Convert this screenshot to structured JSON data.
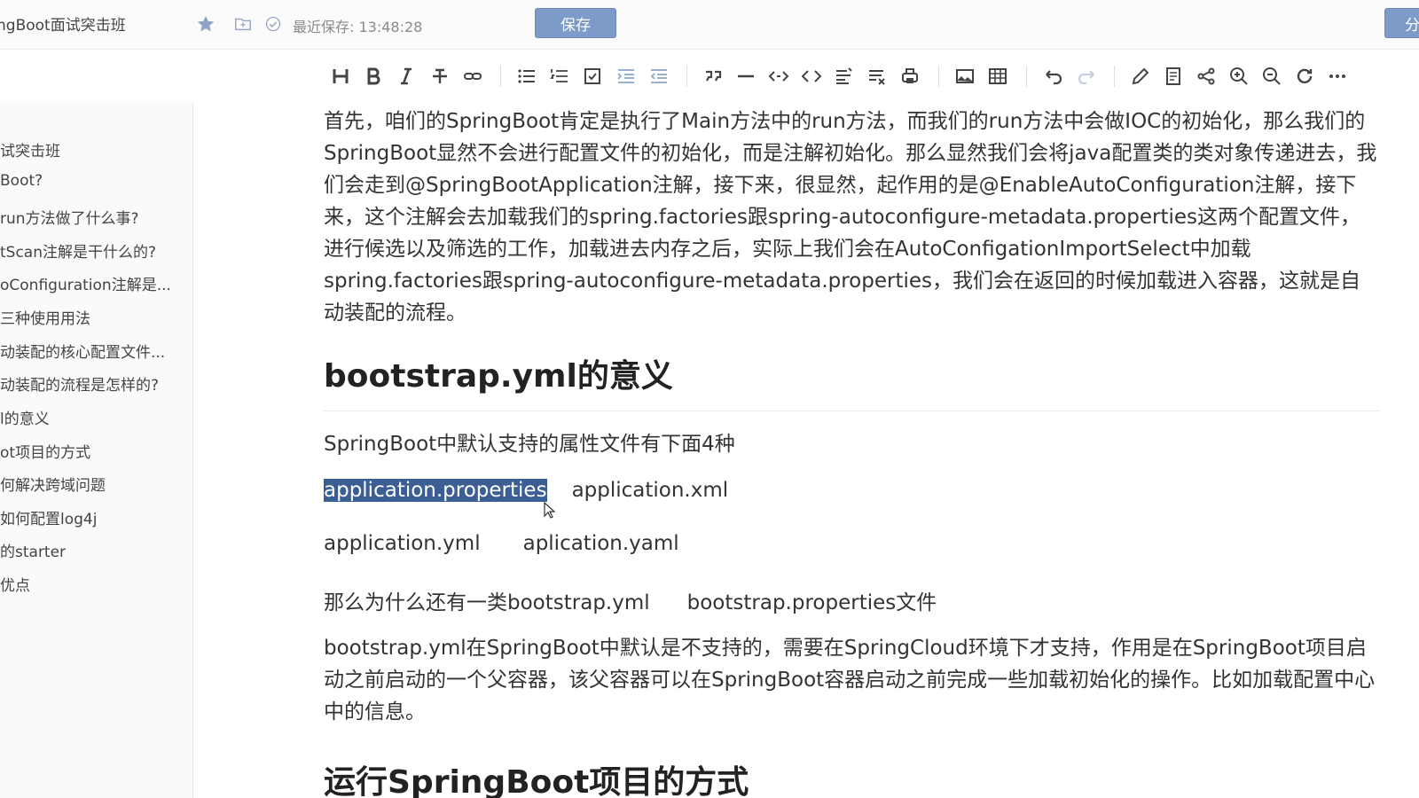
{
  "topbar": {
    "doc_title": "ngBoot面试突击班",
    "save_status": "最近保存: 13:48:28",
    "save_label": "保存",
    "share_label": "分"
  },
  "toolbar": {
    "icons": [
      "heading-icon",
      "bold-icon",
      "italic-icon",
      "strikethrough-icon",
      "link-icon",
      "unordered-list-icon",
      "ordered-list-icon",
      "task-list-icon",
      "indent-icon",
      "outdent-icon",
      "quote-icon",
      "horizontal-rule-icon",
      "inline-code-icon",
      "code-block-icon",
      "align-icon",
      "clear-format-icon",
      "print-icon",
      "image-icon",
      "table-icon",
      "undo-icon",
      "redo-icon",
      "edit-icon",
      "preview-icon",
      "mindmap-icon",
      "zoom-in-icon",
      "zoom-out-icon",
      "refresh-icon",
      "more-icon"
    ]
  },
  "sidebar": {
    "items": [
      {
        "label": "试突击班"
      },
      {
        "label": "Boot?"
      },
      {
        "label": "run方法做了什么事?"
      },
      {
        "label": "tScan注解是干什么的?"
      },
      {
        "label": "oConfiguration注解是..."
      },
      {
        "label": "三种使用用法"
      },
      {
        "label": "动装配的核心配置文件..."
      },
      {
        "label": "动装配的流程是怎样的?"
      },
      {
        "label": "l的意义"
      },
      {
        "label": "ot项目的方式"
      },
      {
        "label": "何解决跨域问题"
      },
      {
        "label": "如何配置log4j"
      },
      {
        "label": "的starter"
      },
      {
        "label": "优点"
      }
    ]
  },
  "content": {
    "intro_paragraph": "首先，咱们的SpringBoot肯定是执行了Main方法中的run方法，而我们的run方法中会做IOC的初始化，那么我们的SpringBoot显然不会进行配置文件的初始化，而是注解初始化。那么显然我们会将java配置类的类对象传递进去，我们会走到@SpringBootApplication注解，接下来，很显然，起作用的是@EnableAutoConfiguration注解，接下来，这个注解会去加载我们的spring.factories跟spring-autoconfigure-metadata.properties这两个配置文件，进行候选以及筛选的工作，加载进去内存之后，实际上我们会在AutoConfigationImportSelect中加载spring.factories跟spring-autoconfigure-metadata.properties，我们会在返回的时候加载进入容器，这就是自动装配的流程。",
    "h2_tag": "H2",
    "heading1": "bootstrap.yml的意义",
    "line1": "SpringBoot中默认支持的属性文件有下面4种",
    "file1": "application.properties",
    "file2": "application.xml",
    "file3": "application.yml",
    "file4": "aplication.yaml",
    "line4a": "那么为什么还有一类bootstrap.yml",
    "line4b": "bootstrap.properties文件",
    "paragraph2": "bootstrap.yml在SpringBoot中默认是不支持的，需要在SpringCloud环境下才支持，作用是在SpringBoot项目启动之前启动的一个父容器，该父容器可以在SpringBoot容器启动之前完成一些加载初始化的操作。比如加载配置中心中的信息。",
    "heading2": "运行SpringBoot项目的方式"
  }
}
